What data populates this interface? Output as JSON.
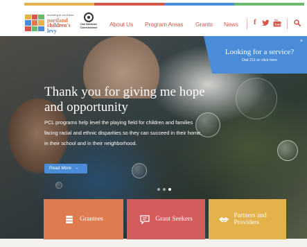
{
  "colors": {
    "accent_red": "#d4574a",
    "accent_blue": "#4a8cd8",
    "grantees_orange": "#e07b50",
    "grant_seekers_red": "#d35c5c",
    "partners_gold": "#e3b24a",
    "topbar": [
      "#e3b24a",
      "#d4574a",
      "#4a8cd8",
      "#6cb86a"
    ]
  },
  "header": {
    "logo": {
      "tagline": "Investing in our future",
      "name_line1": "portland",
      "name_line2": "children's",
      "name_line3": "levy"
    },
    "commissioner": {
      "line1": "Dan Saltzman",
      "line2": "Commissioner"
    },
    "nav": {
      "about": "About Us",
      "program_areas": "Program Areas",
      "grants": "Grants",
      "news": "News"
    },
    "social": {
      "facebook_icon": "f",
      "twitter_icon": "twitter-icon",
      "youtube_icon": "youtube-icon",
      "search_icon": "search-icon"
    }
  },
  "hero": {
    "title": "Thank you for giving me hope and opportunity",
    "body": "PCL programs help level the playing field for children and families facing racial and ethnic disparities so they can succeed in their home, in their school and in their neighborhood.",
    "read_more": "Read More"
  },
  "service_box": {
    "close": "×",
    "question": "Looking for a service?",
    "dial": "Dial 211 or click here"
  },
  "cards": {
    "grantees": "Grantees",
    "grant_seekers": "Grant Seekers",
    "partners": "Partners and Providers"
  }
}
